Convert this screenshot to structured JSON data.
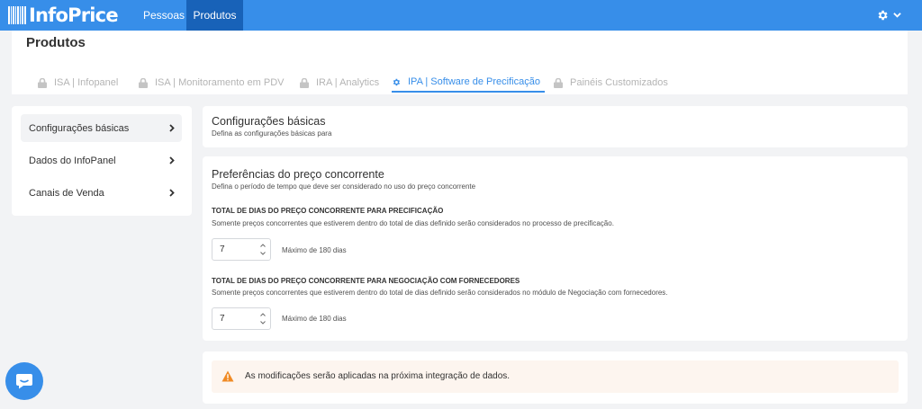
{
  "topbar": {
    "logo_text": "InfoPrice",
    "nav": [
      "Pessoas",
      "Produtos"
    ],
    "settings_icon": "gear-icon",
    "menu_icon": "chevron-down-icon"
  },
  "header": {
    "title": "Produtos",
    "tabs": [
      {
        "label": "ISA | Infopanel",
        "icon": "lock-icon",
        "active": false
      },
      {
        "label": "ISA | Monitoramento em PDV",
        "icon": "lock-icon",
        "active": false
      },
      {
        "label": "IRA | Analytics",
        "icon": "lock-icon",
        "active": false
      },
      {
        "label": "IPA | Software de Precificação",
        "icon": "gear-icon",
        "active": true
      },
      {
        "label": "Painéis Customizados",
        "icon": "lock-icon",
        "active": false
      }
    ]
  },
  "sidebar": {
    "items": [
      {
        "label": "Configurações básicas",
        "active": true
      },
      {
        "label": "Dados do InfoPanel",
        "active": false
      },
      {
        "label": "Canais de Venda",
        "active": false
      }
    ]
  },
  "basic": {
    "title": "Configurações básicas",
    "subtitle": "Defina as configurações básicas para"
  },
  "competitor": {
    "title": "Preferências do preço concorrente",
    "subtitle": "Defina o período de tempo que deve ser considerado no uso do preço concorrente",
    "fields": [
      {
        "label": "TOTAL DE DIAS DO PREÇO CONCORRENTE PARA PRECIFICAÇÃO",
        "description": "Somente preços concorrentes que estiverem dentro do total de dias definido serão considerados no processo de precificação.",
        "value": "7",
        "hint": "Máximo de 180 dias"
      },
      {
        "label": "TOTAL DE DIAS DO PREÇO CONCORRENTE PARA NEGOCIAÇÃO COM FORNECEDORES",
        "description": "Somente preços concorrentes que estiverem dentro do total de dias definido serão considerados no módulo de Negociação com fornecedores.",
        "value": "7",
        "hint": "Máximo de 180 dias"
      }
    ]
  },
  "notice": {
    "icon": "warning-icon",
    "text": "As modificações serão aplicadas na próxima integração de dados."
  },
  "chat": {
    "icon": "chat-icon"
  },
  "colors": {
    "primary": "#378ee9",
    "nav_active": "#1862b8",
    "background": "#f2f3f5",
    "warning": "#f08a24",
    "notice_bg": "#fdf5ef"
  }
}
